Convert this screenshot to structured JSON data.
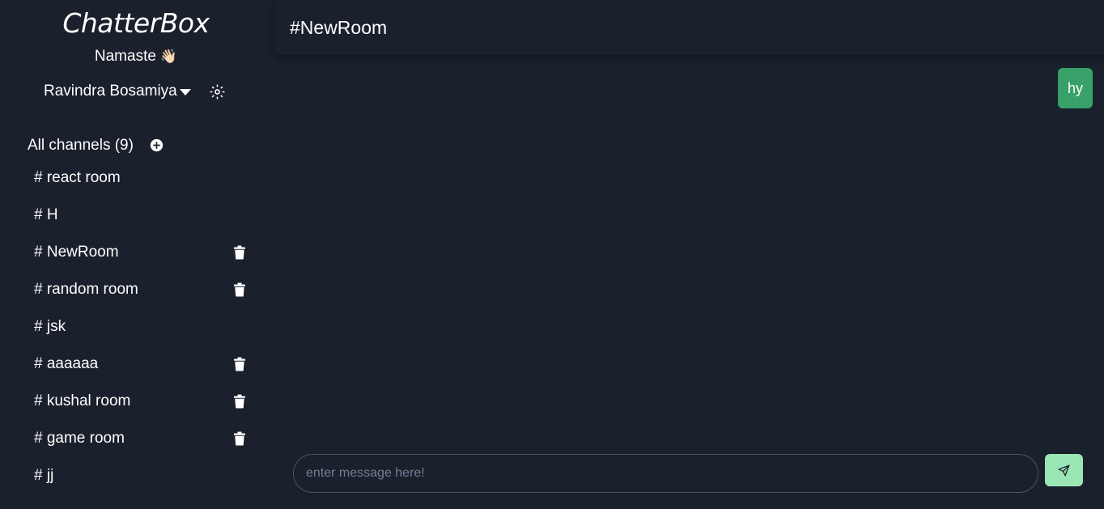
{
  "sidebar": {
    "brand": "ChatterBox",
    "greeting": "Namaste",
    "greeting_emoji": "👋🏻",
    "user_name": "Ravindra Bosamiya",
    "channels_title": "All channels (9)",
    "channels": [
      {
        "label": "# react room",
        "deletable": false
      },
      {
        "label": "# H",
        "deletable": false
      },
      {
        "label": "# NewRoom",
        "deletable": true
      },
      {
        "label": "# random room",
        "deletable": true
      },
      {
        "label": "# jsk",
        "deletable": false
      },
      {
        "label": "# aaaaaa",
        "deletable": true
      },
      {
        "label": "# kushal room",
        "deletable": true
      },
      {
        "label": "# game room",
        "deletable": true
      },
      {
        "label": "# jj",
        "deletable": false
      }
    ]
  },
  "main": {
    "room_title": "#NewRoom",
    "messages": [
      {
        "text": "hy",
        "own": true
      }
    ],
    "composer": {
      "value": "",
      "placeholder": "enter message here!"
    }
  },
  "icons": {
    "theme": "sun-icon",
    "add_channel": "plus-circle-icon",
    "delete_channel": "trash-icon",
    "send": "send-icon",
    "user_menu": "caret-down-icon"
  },
  "colors": {
    "background": "#1a202c",
    "own_message": "#38a169",
    "send_button": "#9ae6b4",
    "text": "#ffffff"
  }
}
